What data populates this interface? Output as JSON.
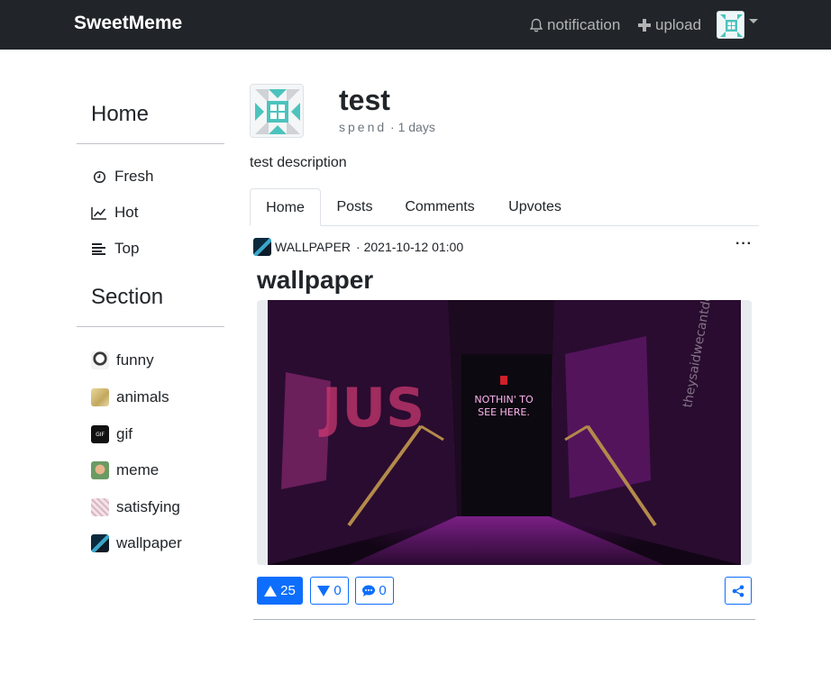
{
  "navbar": {
    "brand": "SweetMeme",
    "notification_label": "notification",
    "upload_label": "upload",
    "bg_color": "#212529"
  },
  "sidebar": {
    "home_heading": "Home",
    "nav_items": [
      {
        "label": "Fresh",
        "icon": "clock-icon"
      },
      {
        "label": "Hot",
        "icon": "trending-icon"
      },
      {
        "label": "Top",
        "icon": "list-icon"
      }
    ],
    "section_heading": "Section",
    "sections": [
      {
        "label": "funny"
      },
      {
        "label": "animals"
      },
      {
        "label": "gif"
      },
      {
        "label": "meme"
      },
      {
        "label": "satisfying"
      },
      {
        "label": "wallpaper"
      }
    ]
  },
  "profile": {
    "name": "test",
    "meta_spend": "spend",
    "meta_days": "· 1 days",
    "description": "test description"
  },
  "tabs": [
    {
      "label": "Home",
      "active": true
    },
    {
      "label": "Posts",
      "active": false
    },
    {
      "label": "Comments",
      "active": false
    },
    {
      "label": "Upvotes",
      "active": false
    }
  ],
  "post": {
    "section": "WALLPAPER",
    "timestamp": "· 2021-10-12 01:00",
    "menu": "···",
    "title": "wallpaper",
    "image_sign_text": "NOTHIN' TO SEE HERE.",
    "upvotes": "25",
    "downvotes": "0",
    "comments": "0"
  },
  "colors": {
    "primary": "#0d6efd",
    "muted": "#6c757d"
  }
}
